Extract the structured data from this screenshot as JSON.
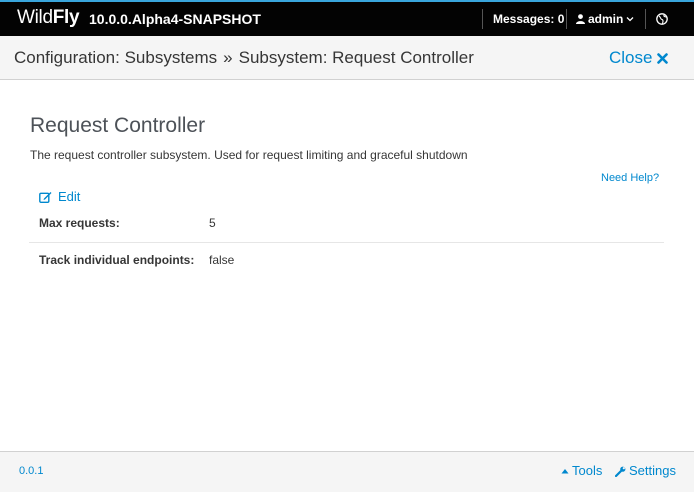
{
  "header": {
    "brand_light": "Wild",
    "brand_bold": "Fly",
    "version": "10.0.0.Alpha4-SNAPSHOT",
    "messages_label": "Messages: 0",
    "user_label": "admin"
  },
  "breadcrumb": {
    "part1": "Configuration: Subsystems",
    "separator": "»",
    "part2": "Subsystem: Request Controller",
    "close_label": "Close"
  },
  "content": {
    "title": "Request Controller",
    "description": "The request controller subsystem. Used for request limiting and graceful shutdown",
    "help_link": "Need Help?",
    "edit_label": "Edit",
    "attributes": [
      {
        "label": "Max requests:",
        "value": "5"
      },
      {
        "label": "Track individual endpoints:",
        "value": "false"
      }
    ]
  },
  "footer": {
    "version": "0.0.1",
    "tools_label": "Tools",
    "settings_label": "Settings"
  },
  "colors": {
    "accent": "#0088ce",
    "topbar": "#030303",
    "topbar_border": "#39a5dc"
  },
  "icons": [
    "user-icon",
    "chevron-down-icon",
    "globe-icon",
    "close-x-icon",
    "edit-icon",
    "caret-up-icon",
    "wrench-icon"
  ]
}
